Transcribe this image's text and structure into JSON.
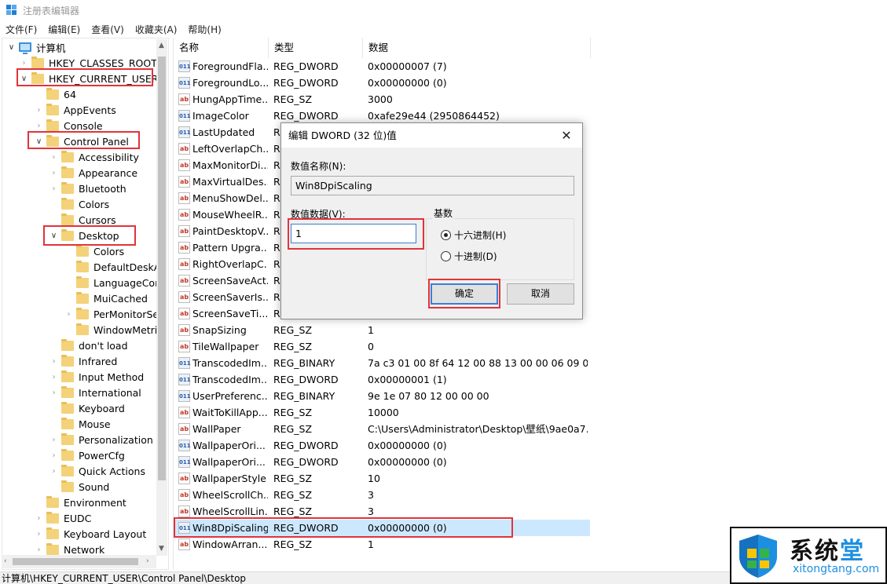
{
  "window": {
    "title": "注册表编辑器"
  },
  "menu": [
    "文件(F)",
    "编辑(E)",
    "查看(V)",
    "收藏夹(A)",
    "帮助(H)"
  ],
  "tree": {
    "root": "计算机",
    "items": [
      {
        "label": "HKEY_CLASSES_ROOT"
      },
      {
        "label": "HKEY_CURRENT_USER"
      },
      {
        "label": "64"
      },
      {
        "label": "AppEvents"
      },
      {
        "label": "Console"
      },
      {
        "label": "Control Panel"
      },
      {
        "label": "Accessibility"
      },
      {
        "label": "Appearance"
      },
      {
        "label": "Bluetooth"
      },
      {
        "label": "Colors"
      },
      {
        "label": "Cursors"
      },
      {
        "label": "Desktop"
      },
      {
        "label": "Colors"
      },
      {
        "label": "DefaultDeskA"
      },
      {
        "label": "LanguageCor"
      },
      {
        "label": "MuiCached"
      },
      {
        "label": "PerMonitorSe"
      },
      {
        "label": "WindowMetri"
      },
      {
        "label": "don't load"
      },
      {
        "label": "Infrared"
      },
      {
        "label": "Input Method"
      },
      {
        "label": "International"
      },
      {
        "label": "Keyboard"
      },
      {
        "label": "Mouse"
      },
      {
        "label": "Personalization"
      },
      {
        "label": "PowerCfg"
      },
      {
        "label": "Quick Actions"
      },
      {
        "label": "Sound"
      },
      {
        "label": "Environment"
      },
      {
        "label": "EUDC"
      },
      {
        "label": "Keyboard Layout"
      },
      {
        "label": "Network"
      }
    ]
  },
  "list": {
    "columns": [
      "名称",
      "类型",
      "数据"
    ],
    "rows": [
      {
        "icon": "bin",
        "name": "ForegroundFla...",
        "type": "REG_DWORD",
        "data": "0x00000007 (7)"
      },
      {
        "icon": "bin",
        "name": "ForegroundLo...",
        "type": "REG_DWORD",
        "data": "0x00000000 (0)"
      },
      {
        "icon": "sz",
        "name": "HungAppTime...",
        "type": "REG_SZ",
        "data": "3000"
      },
      {
        "icon": "bin",
        "name": "ImageColor",
        "type": "REG_DWORD",
        "data": "0xafe29e44 (2950864452)"
      },
      {
        "icon": "bin",
        "name": "LastUpdated",
        "type": "R",
        "data": ""
      },
      {
        "icon": "sz",
        "name": "LeftOverlapCh...",
        "type": "R",
        "data": ""
      },
      {
        "icon": "sz",
        "name": "MaxMonitorDi...",
        "type": "R",
        "data": ""
      },
      {
        "icon": "sz",
        "name": "MaxVirtualDes...",
        "type": "R",
        "data": ""
      },
      {
        "icon": "sz",
        "name": "MenuShowDel...",
        "type": "R",
        "data": ""
      },
      {
        "icon": "sz",
        "name": "MouseWheelR...",
        "type": "R",
        "data": ""
      },
      {
        "icon": "sz",
        "name": "PaintDesktopV...",
        "type": "R",
        "data": ""
      },
      {
        "icon": "sz",
        "name": "Pattern Upgra...",
        "type": "R",
        "data": ""
      },
      {
        "icon": "sz",
        "name": "RightOverlapC...",
        "type": "R",
        "data": ""
      },
      {
        "icon": "sz",
        "name": "ScreenSaveAct...",
        "type": "R",
        "data": ""
      },
      {
        "icon": "sz",
        "name": "ScreenSaverIs...",
        "type": "R",
        "data": ""
      },
      {
        "icon": "sz",
        "name": "ScreenSaveTi...",
        "type": "R",
        "data": ""
      },
      {
        "icon": "sz",
        "name": "SnapSizing",
        "type": "REG_SZ",
        "data": "1"
      },
      {
        "icon": "sz",
        "name": "TileWallpaper",
        "type": "REG_SZ",
        "data": "0"
      },
      {
        "icon": "bin",
        "name": "TranscodedIm...",
        "type": "REG_BINARY",
        "data": "7a c3 01 00 8f 64 12 00 88 13 00 00 06 09 00..."
      },
      {
        "icon": "bin",
        "name": "TranscodedIm...",
        "type": "REG_DWORD",
        "data": "0x00000001 (1)"
      },
      {
        "icon": "bin",
        "name": "UserPreferenc...",
        "type": "REG_BINARY",
        "data": "9e 1e 07 80 12 00 00 00"
      },
      {
        "icon": "sz",
        "name": "WaitToKillApp...",
        "type": "REG_SZ",
        "data": "10000"
      },
      {
        "icon": "sz",
        "name": "WallPaper",
        "type": "REG_SZ",
        "data": "C:\\Users\\Administrator\\Desktop\\壁纸\\9ae0a7..."
      },
      {
        "icon": "bin",
        "name": "WallpaperOri...",
        "type": "REG_DWORD",
        "data": "0x00000000 (0)"
      },
      {
        "icon": "bin",
        "name": "WallpaperOri...",
        "type": "REG_DWORD",
        "data": "0x00000000 (0)"
      },
      {
        "icon": "sz",
        "name": "WallpaperStyle",
        "type": "REG_SZ",
        "data": "10"
      },
      {
        "icon": "sz",
        "name": "WheelScrollCh...",
        "type": "REG_SZ",
        "data": "3"
      },
      {
        "icon": "sz",
        "name": "WheelScrollLin...",
        "type": "REG_SZ",
        "data": "3"
      },
      {
        "icon": "bin",
        "name": "Win8DpiScaling",
        "type": "REG_DWORD",
        "data": "0x00000000 (0)"
      },
      {
        "icon": "sz",
        "name": "WindowArran...",
        "type": "REG_SZ",
        "data": "1"
      }
    ]
  },
  "dialog": {
    "title": "编辑 DWORD (32 位)值",
    "close": "✕",
    "name_label": "数值名称(N):",
    "name_value": "Win8DpiScaling",
    "data_label": "数值数据(V):",
    "data_value": "1",
    "base_label": "基数",
    "hex_label": "十六进制(H)",
    "dec_label": "十进制(D)",
    "ok": "确定",
    "cancel": "取消"
  },
  "status": {
    "path": "计算机\\HKEY_CURRENT_USER\\Control Panel\\Desktop"
  },
  "watermark": {
    "brand_a": "系统",
    "brand_b": "堂",
    "url": "xitongtang.com"
  },
  "colors": {
    "highlight_box": "#e2333a",
    "selection": "#cce8ff",
    "accent": "#3b7fd4"
  }
}
